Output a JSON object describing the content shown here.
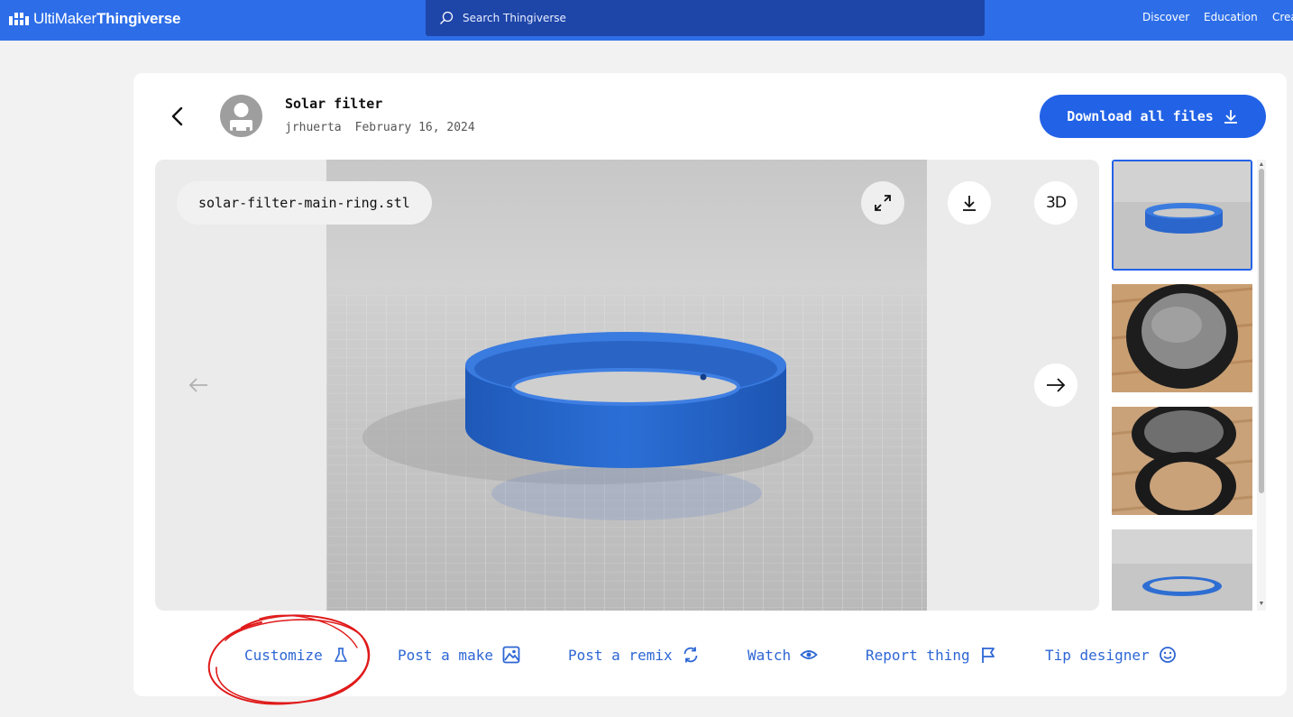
{
  "header": {
    "logo_brand": "UltiMaker",
    "logo_product": "Thingiverse",
    "search_placeholder": "Search Thingiverse",
    "nav": [
      "Discover",
      "Education",
      "Crea"
    ]
  },
  "thing": {
    "title": "Solar filter",
    "author": "jrhuerta",
    "date": "February 16, 2024",
    "download_label": "Download all files"
  },
  "viewer": {
    "file_name": "solar-filter-main-ring.stl",
    "mode_label": "3D",
    "thumbnails": [
      {
        "icon": "ring-render",
        "selected": true
      },
      {
        "icon": "filter-photo",
        "selected": false
      },
      {
        "icon": "parts-photo",
        "selected": false
      },
      {
        "icon": "flat-ring-render",
        "selected": false
      }
    ]
  },
  "actions": [
    {
      "label": "Customize",
      "icon": "flask-icon"
    },
    {
      "label": "Post a make",
      "icon": "image-icon"
    },
    {
      "label": "Post a remix",
      "icon": "remix-icon"
    },
    {
      "label": "Watch",
      "icon": "eye-icon"
    },
    {
      "label": "Report thing",
      "icon": "flag-icon"
    },
    {
      "label": "Tip designer",
      "icon": "smiley-icon"
    }
  ],
  "colors": {
    "brand": "#2d6ee8",
    "search_bg": "#1e45a8",
    "accent": "#2262e6",
    "link": "#2d66d4",
    "annotation": "#e01a1a"
  }
}
